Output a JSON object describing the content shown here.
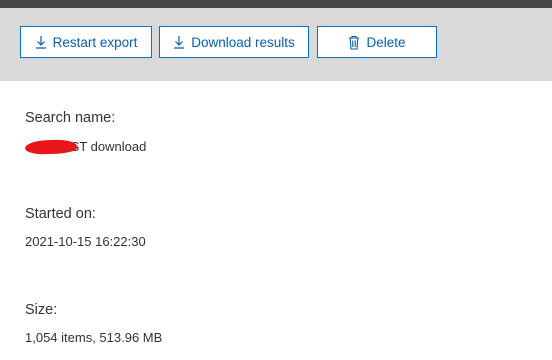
{
  "toolbar": {
    "restart_label": "Restart export",
    "download_label": "Download results",
    "delete_label": "Delete",
    "icons": {
      "restart": "download-arrow-icon",
      "download": "download-arrow-icon",
      "delete": "trash-icon"
    },
    "accent_color": "#106ebe"
  },
  "details": {
    "search_name_label": "Search name:",
    "search_name_value": "PST download",
    "started_label": "Started on:",
    "started_value": "2021-10-15 16:22:30",
    "size_label": "Size:",
    "size_value": "1,054 items, 513.96 MB"
  }
}
